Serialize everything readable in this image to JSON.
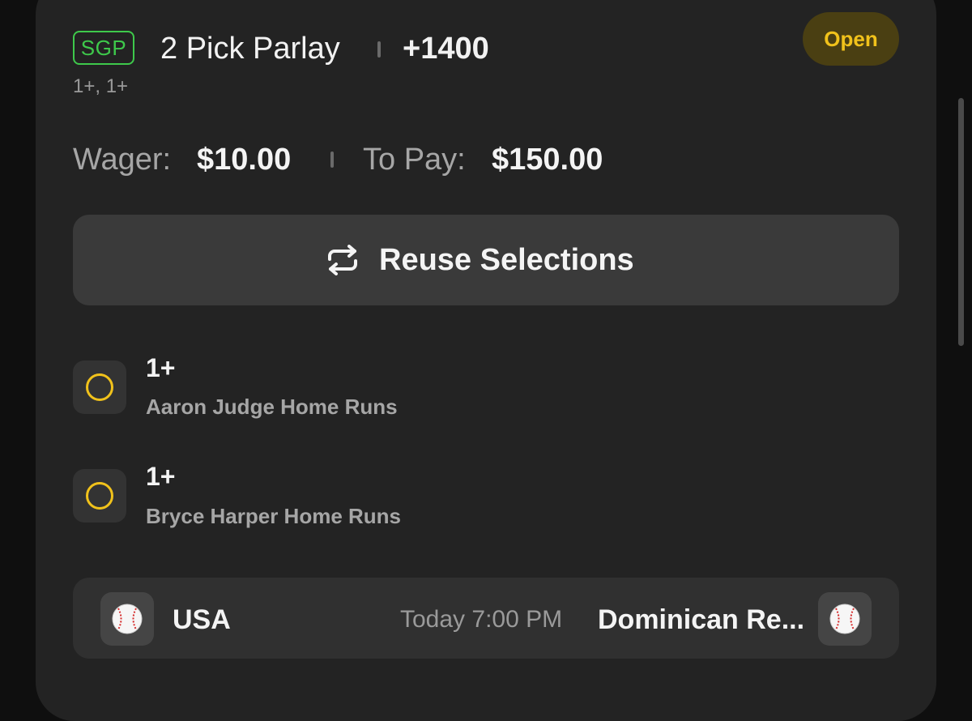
{
  "bet": {
    "badge": "SGP",
    "title": "2 Pick Parlay",
    "odds": "+1400",
    "subtitle": "1+, 1+",
    "status": "Open"
  },
  "wager": {
    "wager_label": "Wager:",
    "wager_value": "$10.00",
    "to_pay_label": "To Pay:",
    "to_pay_value": "$150.00"
  },
  "reuse": {
    "label": "Reuse Selections",
    "icon": "repeat-icon"
  },
  "legs": [
    {
      "line": "1+",
      "market": "Aaron Judge Home Runs",
      "status_icon": "pending-circle-icon"
    },
    {
      "line": "1+",
      "market": "Bryce Harper Home Runs",
      "status_icon": "pending-circle-icon"
    }
  ],
  "game": {
    "home_team": "USA",
    "time": "Today 7:00 PM",
    "away_team": "Dominican Re...",
    "team_icon": "baseball-icon"
  },
  "colors": {
    "accent_green": "#3ec94b",
    "pending_yellow": "#f1c21b",
    "card_bg": "#232323"
  }
}
